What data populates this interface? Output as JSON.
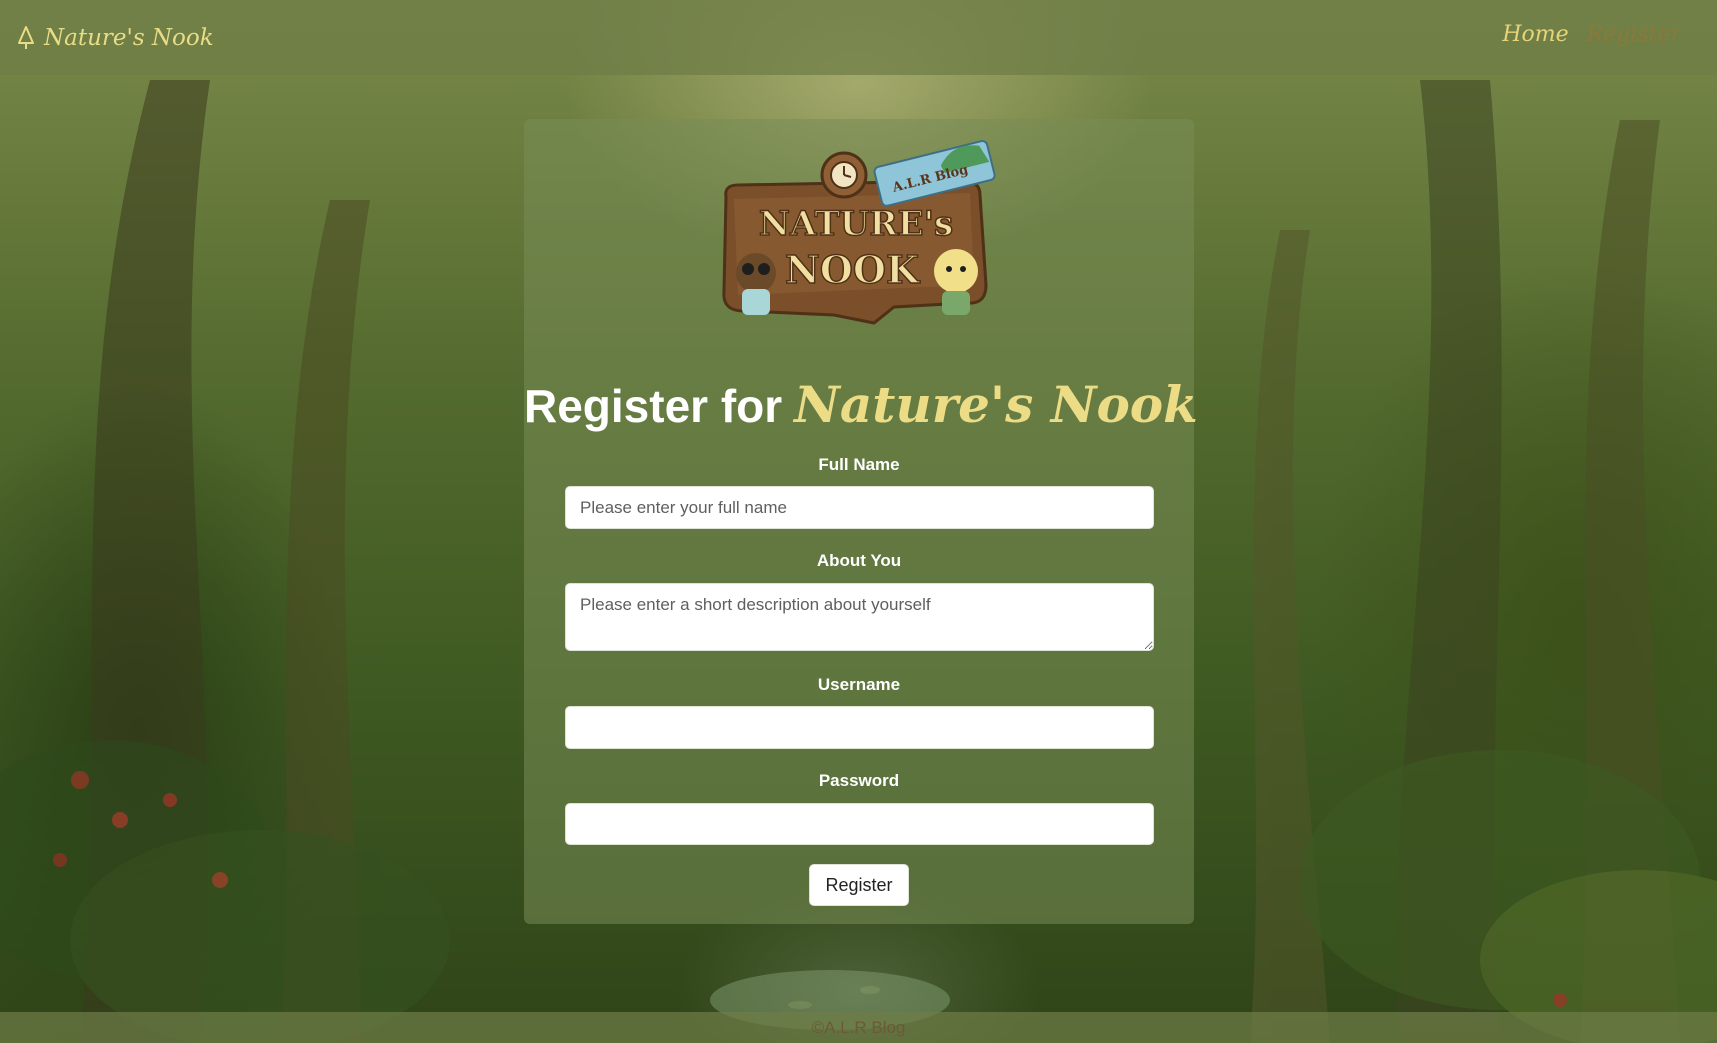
{
  "navbar": {
    "brand_icon": "tree-icon",
    "brand_text": "Nature's Nook",
    "links": [
      {
        "label": "Home"
      },
      {
        "label": "Register"
      }
    ]
  },
  "logo": {
    "line1": "NATURE's",
    "line2": "NOOK",
    "tag": "A.L.R Blog"
  },
  "heading": {
    "prefix": "Register for",
    "emphasis": "Nature's Nook"
  },
  "form": {
    "full_name": {
      "label": "Full Name",
      "placeholder": "Please enter your full name",
      "value": ""
    },
    "about": {
      "label": "About You",
      "placeholder": "Please enter a short description about yourself",
      "value": ""
    },
    "username": {
      "label": "Username",
      "placeholder": "",
      "value": ""
    },
    "password": {
      "label": "Password",
      "placeholder": "",
      "value": ""
    },
    "submit_label": "Register"
  },
  "footer": {
    "text": "©A.L.R Blog"
  },
  "colors": {
    "accent_yellow": "#ecdc86",
    "nav_active": "#e6d47a",
    "nav_inactive": "#8a7a3a",
    "footer_text": "#6b5a34"
  }
}
